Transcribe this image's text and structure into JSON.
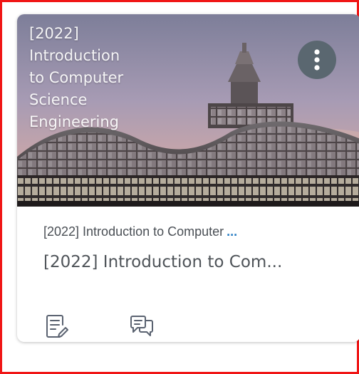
{
  "card": {
    "image_title": "[2022]\nIntroduction\nto Computer\nScience\nEngineering",
    "course_code": "[2022] Introduction to Computer",
    "course_code_ellipsis": "...",
    "course_name": "[2022] Introduction to Com...",
    "menu_icon": "kebab-menu-icon",
    "actions": [
      {
        "icon": "assignments-icon"
      },
      {
        "icon": "discussions-icon"
      }
    ]
  },
  "colors": {
    "frame": "#f01616",
    "menu_button": "#5a6770",
    "ellipsis": "#2a7fc5",
    "icon_stroke": "#5a6270"
  }
}
